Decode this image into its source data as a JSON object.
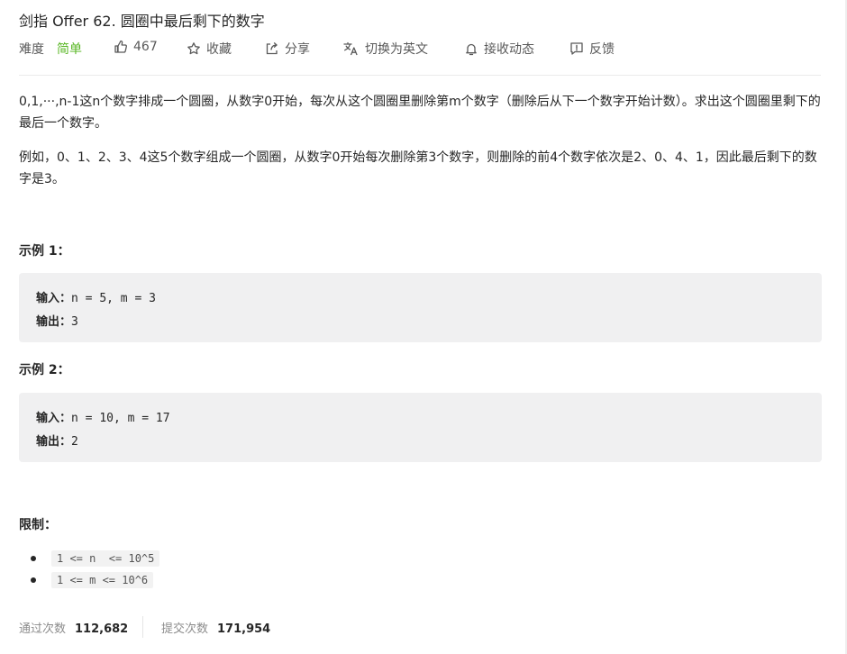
{
  "problem": {
    "title": "剑指 Offer 62. 圆圈中最后剩下的数字"
  },
  "meta": {
    "difficulty_label": "难度",
    "difficulty_value": "简单",
    "likes": "467",
    "favorite": "收藏",
    "share": "分享",
    "switch_lang": "切换为英文",
    "subscribe": "接收动态",
    "feedback": "反馈"
  },
  "description": {
    "p1": "0,1,···,n-1这n个数字排成一个圆圈，从数字0开始，每次从这个圆圈里删除第m个数字（删除后从下一个数字开始计数）。求出这个圆圈里剩下的最后一个数字。",
    "p2": "例如，0、1、2、3、4这5个数字组成一个圆圈，从数字0开始每次删除第3个数字，则删除的前4个数字依次是2、0、4、1，因此最后剩下的数字是3。"
  },
  "examples": [
    {
      "heading": "示例 1：",
      "input_label": "输入：",
      "input_value": "n = 5, m = 3",
      "output_label": "输出：",
      "output_value": "3"
    },
    {
      "heading": "示例 2：",
      "input_label": "输入：",
      "input_value": "n = 10, m = 17",
      "output_label": "输出：",
      "output_value": "2"
    }
  ],
  "constraints": {
    "heading": "限制：",
    "items": [
      "1 <= n  <= 10^5",
      "1 <= m <= 10^6"
    ]
  },
  "stats": {
    "accepted_label": "通过次数",
    "accepted_value": "112,682",
    "submitted_label": "提交次数",
    "submitted_value": "171,954"
  },
  "colors": {
    "easy": "#5ab726",
    "code_bg": "#f0f0f1"
  }
}
